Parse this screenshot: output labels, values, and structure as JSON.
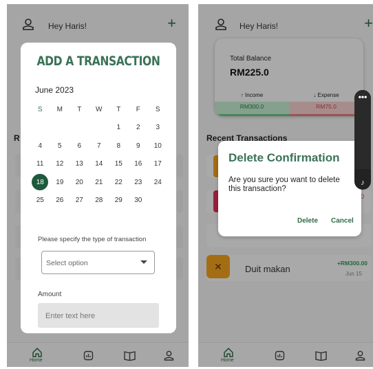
{
  "screen1": {
    "header": {
      "greeting": "Hey Haris!",
      "add_icon": "plus-icon"
    },
    "side_letter": "R",
    "modal": {
      "title": "ADD A TRANSACTION",
      "month": "June 2023",
      "weekdays": [
        "S",
        "M",
        "T",
        "W",
        "T",
        "F",
        "S"
      ],
      "weeks": [
        [
          "",
          "",
          "",
          "",
          "1",
          "2",
          "3"
        ],
        [
          "4",
          "5",
          "6",
          "7",
          "8",
          "9",
          "10"
        ],
        [
          "11",
          "12",
          "13",
          "14",
          "15",
          "16",
          "17"
        ],
        [
          "18",
          "19",
          "20",
          "21",
          "22",
          "23",
          "24"
        ],
        [
          "25",
          "26",
          "27",
          "28",
          "29",
          "30",
          ""
        ]
      ],
      "selected_day": "18",
      "type_label": "Please specify the type of transaction",
      "type_placeholder": "Select option",
      "amount_label": "Amount",
      "amount_placeholder": "Enter text here"
    },
    "nav": {
      "home_label": "Home"
    }
  },
  "screen2": {
    "header": {
      "greeting": "Hey Haris!"
    },
    "balance": {
      "label": "Total Balance",
      "amount": "RM225.0",
      "income_label": "Income",
      "income_value": "RM300.0",
      "expense_label": "Expense",
      "expense_value": "RM75.0"
    },
    "recent_title": "Recent Transactions",
    "partial_amount": "0",
    "transaction": {
      "name": "Duit makan",
      "amount": "+RM300.00",
      "date": "Jun 15"
    },
    "dialog": {
      "title": "Delete Confirmation",
      "message": "Are you sure you want to delete this transaction?",
      "delete_label": "Delete",
      "cancel_label": "Cancel"
    },
    "nav": {
      "home_label": "Home"
    }
  },
  "colors": {
    "brand_green": "#2e6b45",
    "title_green": "#3a7357",
    "income_green": "#c4ecd0",
    "expense_red": "#f6cfcf"
  }
}
